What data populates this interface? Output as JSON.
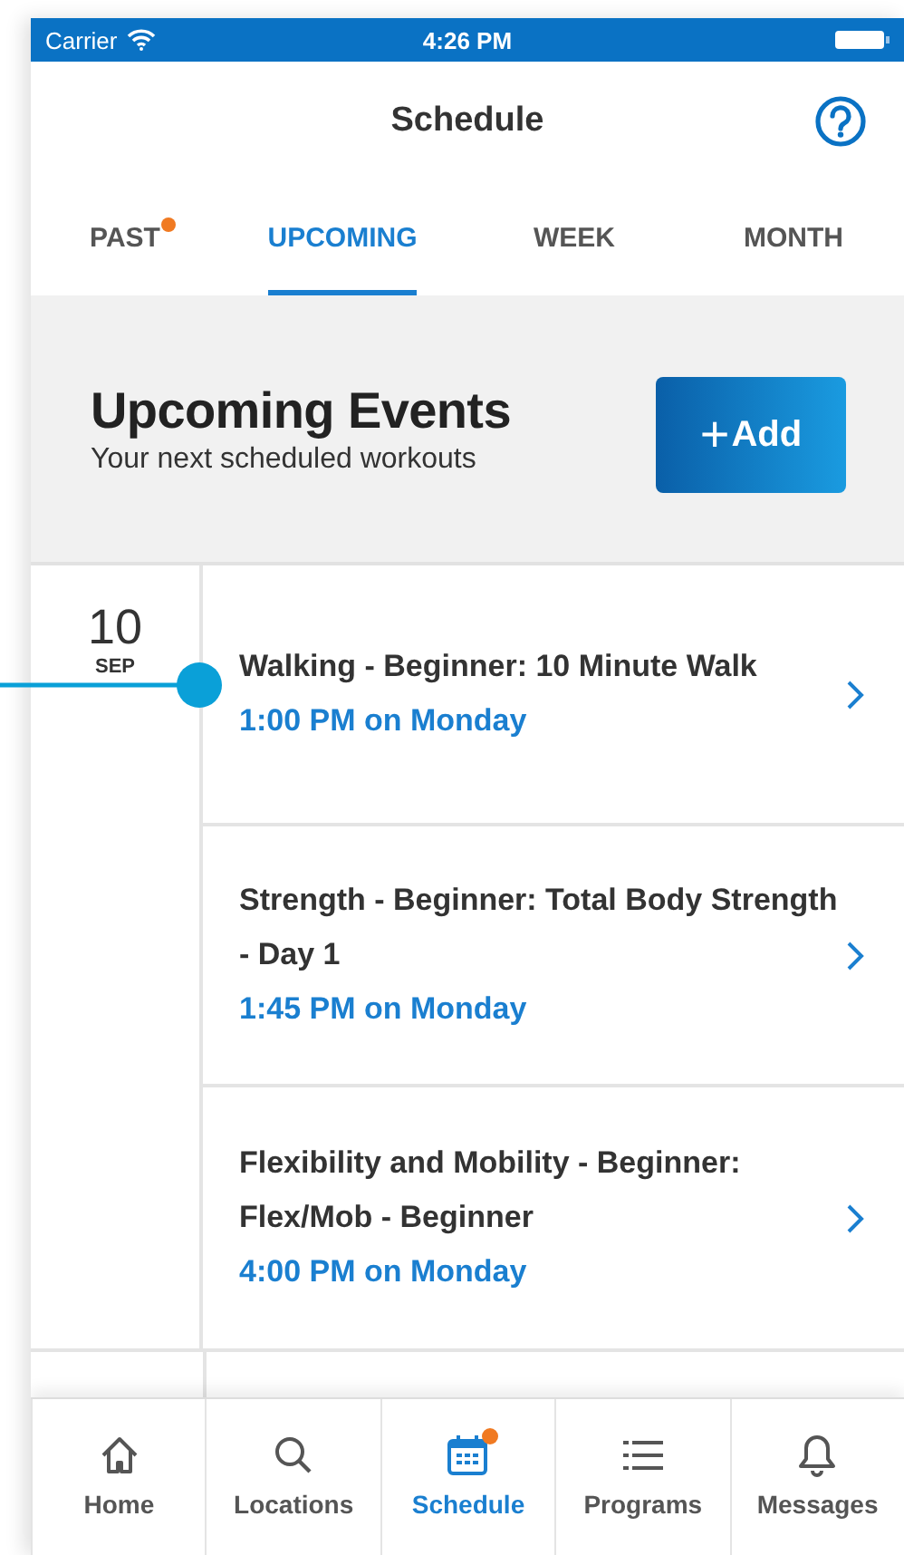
{
  "status_bar": {
    "carrier": "Carrier",
    "time": "4:26 PM"
  },
  "header": {
    "title": "Schedule"
  },
  "tabs": [
    {
      "label": "PAST",
      "selected": false,
      "badge": true
    },
    {
      "label": "UPCOMING",
      "selected": true,
      "badge": false
    },
    {
      "label": "WEEK",
      "selected": false,
      "badge": false
    },
    {
      "label": "MONTH",
      "selected": false,
      "badge": false
    }
  ],
  "section": {
    "title": "Upcoming Events",
    "subtitle": "Your next scheduled workouts",
    "add_button": {
      "icon": "+",
      "label": "Add"
    }
  },
  "days": [
    {
      "day": "10",
      "month": "SEP",
      "events": [
        {
          "title": "Walking - Beginner: 10 Minute Walk",
          "time": "1:00 PM on Monday"
        },
        {
          "title": "Strength - Beginner: Total Body Strength - Day 1",
          "time": "1:45 PM on Monday"
        },
        {
          "title": "Flexibility and Mobility - Beginner: Flex/Mob - Beginner",
          "time": "4:00 PM on Monday"
        }
      ]
    }
  ],
  "nav": [
    {
      "kind": "home",
      "label": "Home",
      "selected": false,
      "badge": false
    },
    {
      "kind": "search",
      "label": "Locations",
      "selected": false,
      "badge": false
    },
    {
      "kind": "calendar",
      "label": "Schedule",
      "selected": true,
      "badge": true
    },
    {
      "kind": "list",
      "label": "Programs",
      "selected": false,
      "badge": false
    },
    {
      "kind": "bell",
      "label": "Messages",
      "selected": false,
      "badge": false
    }
  ]
}
